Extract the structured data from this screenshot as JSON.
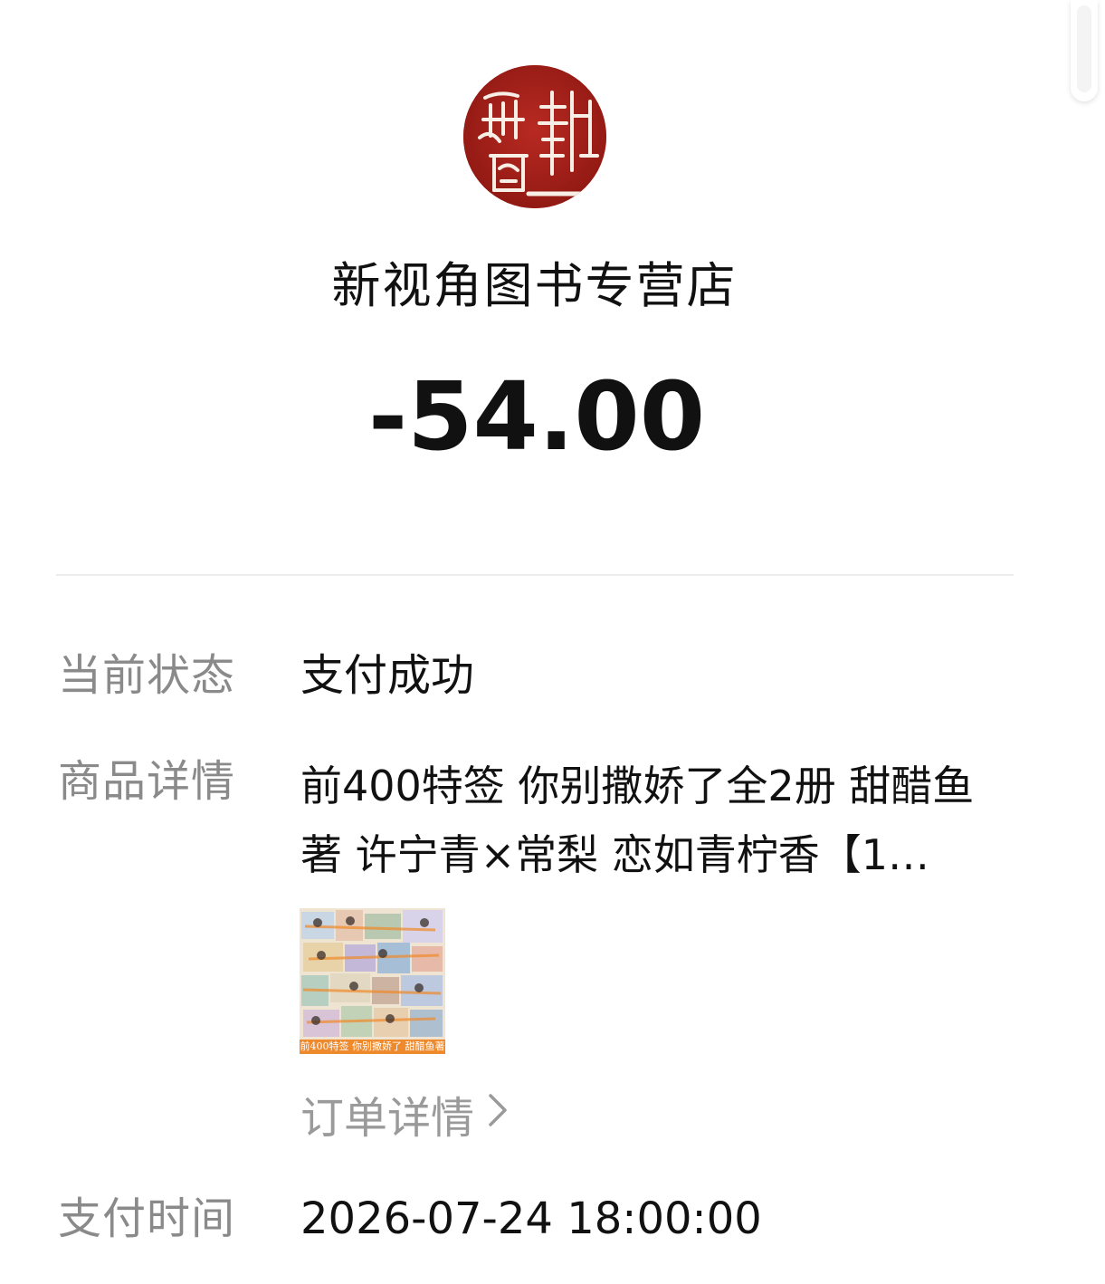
{
  "merchant": {
    "name": "新视角图书专营店",
    "logo_text": "新视角图"
  },
  "amount": "-54.00",
  "fields": {
    "status": {
      "label": "当前状态",
      "value": "支付成功"
    },
    "product": {
      "label": "商品详情",
      "title": "前400特签 你别撒娇了全2册 甜醋鱼著 许宁青×常梨 恋如青柠香【1…",
      "thumbnail_caption": "前400特签 你别撒娇了 甜醋鱼著"
    },
    "order_link": {
      "label": "订单详情",
      "icon": "chevron-right-icon"
    },
    "pay_time": {
      "label": "支付时间",
      "value": "2026-07-24 18:00:00"
    }
  },
  "colors": {
    "label_gray": "#8a8a8a",
    "link_gray": "#9a9a9a",
    "text_dark": "#111111",
    "logo_red": "#a3201a",
    "divider": "#ececec"
  }
}
